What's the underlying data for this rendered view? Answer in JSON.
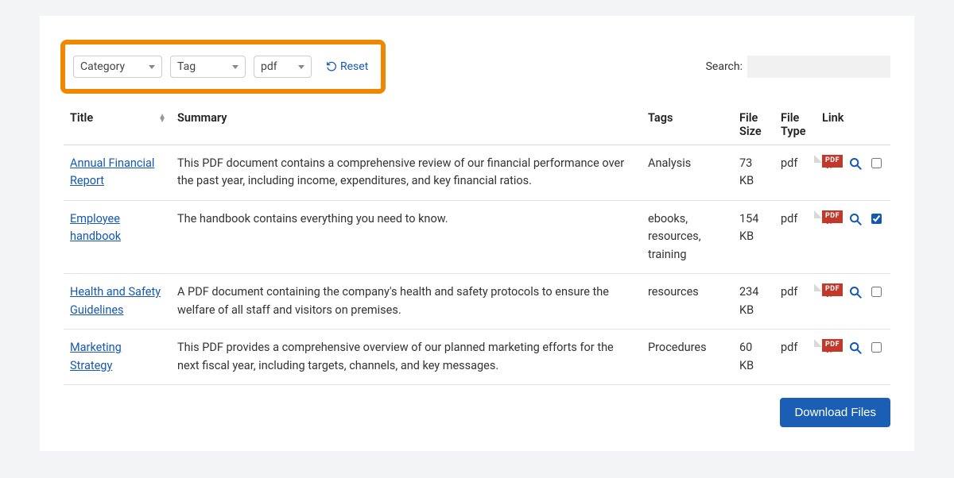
{
  "filters": {
    "category": {
      "label": "Category"
    },
    "tag": {
      "label": "Tag"
    },
    "filetype": {
      "selected": "pdf"
    },
    "reset_label": "Reset"
  },
  "search": {
    "label": "Search:",
    "value": ""
  },
  "columns": {
    "title": "Title",
    "summary": "Summary",
    "tags": "Tags",
    "size": "File Size",
    "type": "File Type",
    "link": "Link"
  },
  "rows": [
    {
      "title": "Annual Financial Report",
      "summary": "This PDF document contains a comprehensive review of our financial performance over the past year, including income, expenditures, and key financial ratios.",
      "tags": "Analysis",
      "size": "73 KB",
      "type": "pdf",
      "checked": false
    },
    {
      "title": "Employee handbook",
      "summary": "The handbook contains everything you need to know.",
      "tags": "ebooks, resources, training",
      "size": "154 KB",
      "type": "pdf",
      "checked": true
    },
    {
      "title": "Health and Safety Guidelines",
      "summary": "A PDF document containing the company's health and safety protocols to ensure the welfare of all staff and visitors on premises.",
      "tags": "resources",
      "size": "234 KB",
      "type": "pdf",
      "checked": false
    },
    {
      "title": "Marketing Strategy",
      "summary": "This PDF provides a comprehensive overview of our planned marketing efforts for the next fiscal year, including targets, channels, and key messages.",
      "tags": "Procedures",
      "size": "60 KB",
      "type": "pdf",
      "checked": false
    }
  ],
  "actions": {
    "download_label": "Download Files"
  },
  "icons": {
    "pdf_badge": "PDF"
  }
}
